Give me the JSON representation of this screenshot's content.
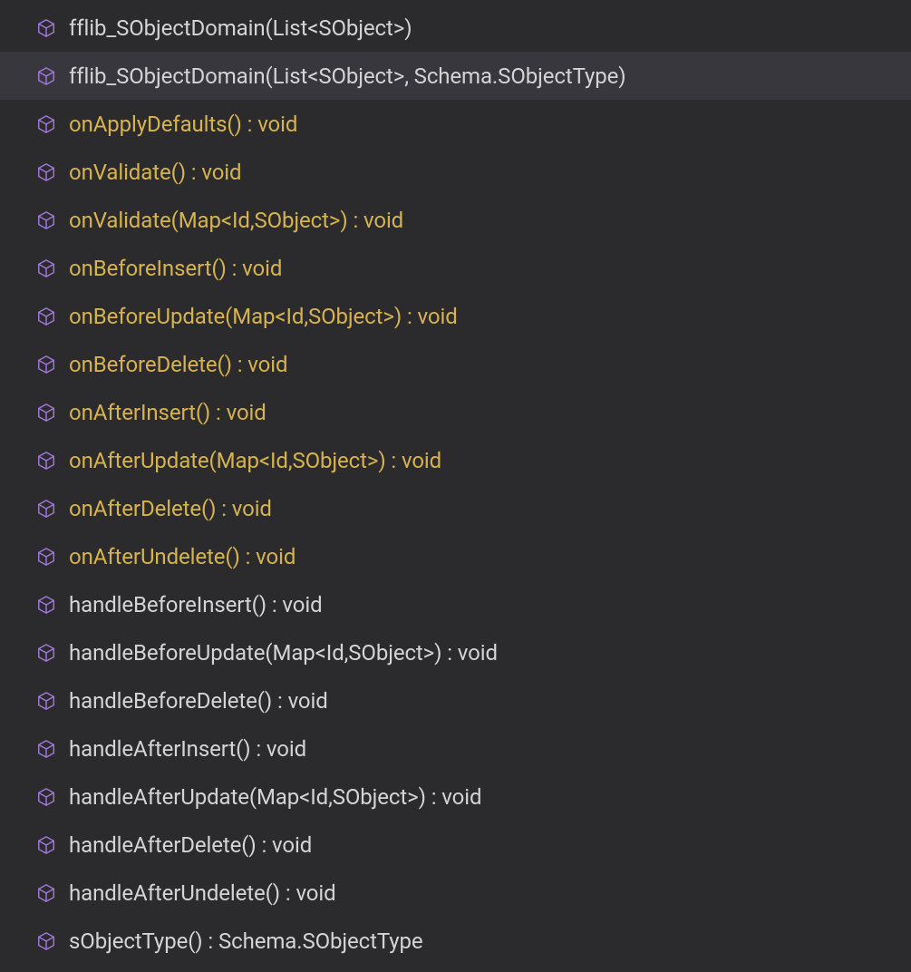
{
  "outline": {
    "items": [
      {
        "label": "fflib_SObjectDomain(List<SObject>)",
        "color": "white",
        "selected": false
      },
      {
        "label": "fflib_SObjectDomain(List<SObject>, Schema.SObjectType)",
        "color": "white",
        "selected": true
      },
      {
        "label": "onApplyDefaults() : void",
        "color": "yellow",
        "selected": false
      },
      {
        "label": "onValidate() : void",
        "color": "yellow",
        "selected": false
      },
      {
        "label": "onValidate(Map<Id,SObject>) : void",
        "color": "yellow",
        "selected": false
      },
      {
        "label": "onBeforeInsert() : void",
        "color": "yellow",
        "selected": false
      },
      {
        "label": "onBeforeUpdate(Map<Id,SObject>) : void",
        "color": "yellow",
        "selected": false
      },
      {
        "label": "onBeforeDelete() : void",
        "color": "yellow",
        "selected": false
      },
      {
        "label": "onAfterInsert() : void",
        "color": "yellow",
        "selected": false
      },
      {
        "label": "onAfterUpdate(Map<Id,SObject>) : void",
        "color": "yellow",
        "selected": false
      },
      {
        "label": "onAfterDelete() : void",
        "color": "yellow",
        "selected": false
      },
      {
        "label": "onAfterUndelete() : void",
        "color": "yellow",
        "selected": false
      },
      {
        "label": "handleBeforeInsert() : void",
        "color": "white",
        "selected": false
      },
      {
        "label": "handleBeforeUpdate(Map<Id,SObject>) : void",
        "color": "white",
        "selected": false
      },
      {
        "label": "handleBeforeDelete() : void",
        "color": "white",
        "selected": false
      },
      {
        "label": "handleAfterInsert() : void",
        "color": "white",
        "selected": false
      },
      {
        "label": "handleAfterUpdate(Map<Id,SObject>) : void",
        "color": "white",
        "selected": false
      },
      {
        "label": "handleAfterDelete() : void",
        "color": "white",
        "selected": false
      },
      {
        "label": "handleAfterUndelete() : void",
        "color": "white",
        "selected": false
      },
      {
        "label": "sObjectType() : Schema.SObjectType",
        "color": "white",
        "selected": false
      }
    ]
  },
  "icon_name": "method-cube-icon"
}
